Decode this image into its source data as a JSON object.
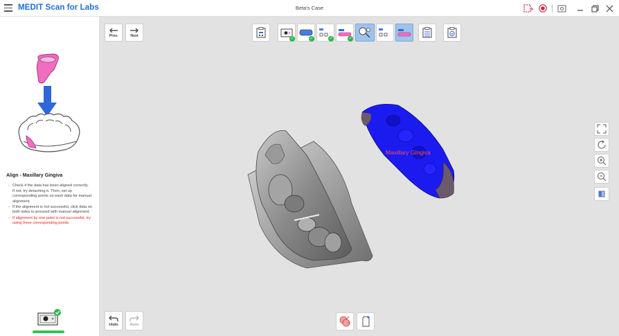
{
  "app": {
    "title": "MEDIT Scan for Labs",
    "window_title": "Beta's Case"
  },
  "titlebar_icons": [
    "screen-record-icon",
    "record-icon",
    "capture-icon",
    "minimize-icon",
    "maximize-icon",
    "close-icon"
  ],
  "toolbar": {
    "prev_label": "Prev.",
    "next_label": "Next",
    "undo_label": "Undo",
    "redo_label": "Redo"
  },
  "step": {
    "title": "Align - Maxillary Gingiva",
    "instructions": [
      "Check if the data has been aligned correctly.\nIf not, try detaching it. Then, set up corresponding points on each data for manual alignment.",
      "If the alignment is not successful, click data on both sides to proceed with manual alignment."
    ],
    "warning": "If alignment by one point is not successful, try using three corresponding points."
  },
  "viewport": {
    "label": "Maxillary Gingiva"
  },
  "colors": {
    "accent": "#1d6fd4",
    "gingiva_blue": "#1b1bf0",
    "warning_red": "#e02020",
    "success_green": "#33c15a",
    "active_step": "#9fc3ea"
  }
}
